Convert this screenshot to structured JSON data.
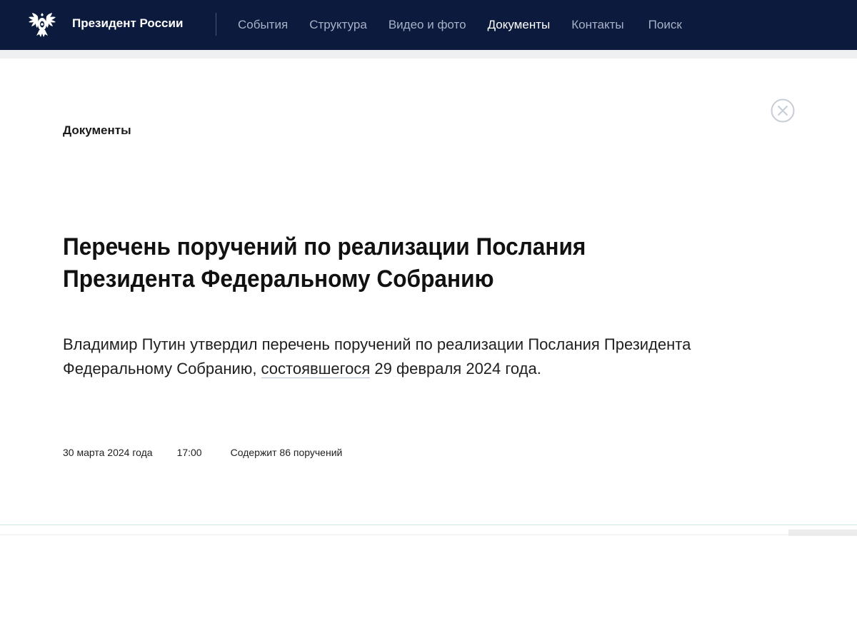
{
  "header": {
    "site_title": "Президент России",
    "nav": [
      {
        "label": "События"
      },
      {
        "label": "Структура"
      },
      {
        "label": "Видео и фото"
      },
      {
        "label": "Документы"
      },
      {
        "label": "Контакты"
      },
      {
        "label": "Поиск"
      }
    ],
    "active_nav": "Документы"
  },
  "document": {
    "section": "Документы",
    "title_line1": "Перечень поручений по реализации Послания",
    "title_line2": "Президента Федеральному Собранию",
    "lead_before": "Владимир Путин утвердил перечень поручений по реализации Послания Президента Федеральному Собранию, ",
    "lead_link": "состоявшегося",
    "lead_after": " 29 февраля 2024 года.",
    "date": "30 марта 2024 года",
    "time": "17:00",
    "count": "Содержит 86 поручений"
  },
  "colors": {
    "header_bg": "#0b1a3d",
    "nav_inactive": "#a8b1c7",
    "nav_active": "#ffffff"
  },
  "icons": {
    "emblem": "double-headed-eagle-icon",
    "close": "close-circle-icon"
  }
}
